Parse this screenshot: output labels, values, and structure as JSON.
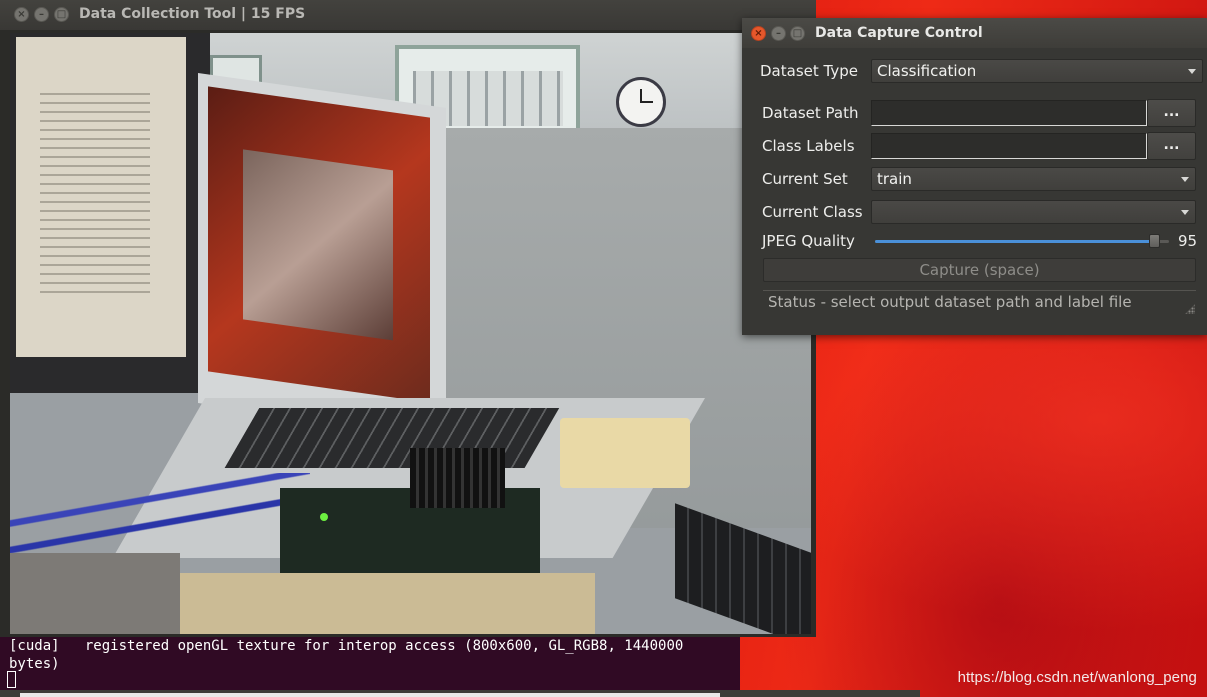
{
  "desktop": {
    "watermark": "https://blog.csdn.net/wanlong_peng"
  },
  "terminal": {
    "output": "[cuda]   registered openGL texture for interop access (800x600, GL_RGB8, 1440000 bytes)"
  },
  "main_window": {
    "title": "Data Collection Tool | 15 FPS",
    "close_glyph": "×",
    "minimize_glyph": "–",
    "maximize_glyph": "□"
  },
  "control_window": {
    "title": "Data Capture Control",
    "close_glyph": "×",
    "minimize_glyph": "–",
    "maximize_glyph": "□",
    "dataset_type": {
      "label": "Dataset Type",
      "value": "Classification"
    },
    "dataset_path": {
      "label": "Dataset Path",
      "value": "",
      "browse_label": "..."
    },
    "class_labels": {
      "label": "Class Labels",
      "value": "",
      "browse_label": "..."
    },
    "current_set": {
      "label": "Current Set",
      "value": "train"
    },
    "current_class": {
      "label": "Current Class",
      "value": ""
    },
    "jpeg_quality": {
      "label": "JPEG Quality",
      "value": 95,
      "min": 0,
      "max": 100,
      "display": "95"
    },
    "capture_button": "Capture (space)",
    "status": "Status - select output dataset path and label file"
  },
  "colors": {
    "accent_slider": "#4a90d9",
    "window_bg": "#373734",
    "terminal_bg": "#300a24",
    "close_button": "#e5572b"
  },
  "icons": [
    "close-icon",
    "minimize-icon",
    "maximize-icon",
    "chevron-down-icon",
    "size-grip-icon"
  ]
}
